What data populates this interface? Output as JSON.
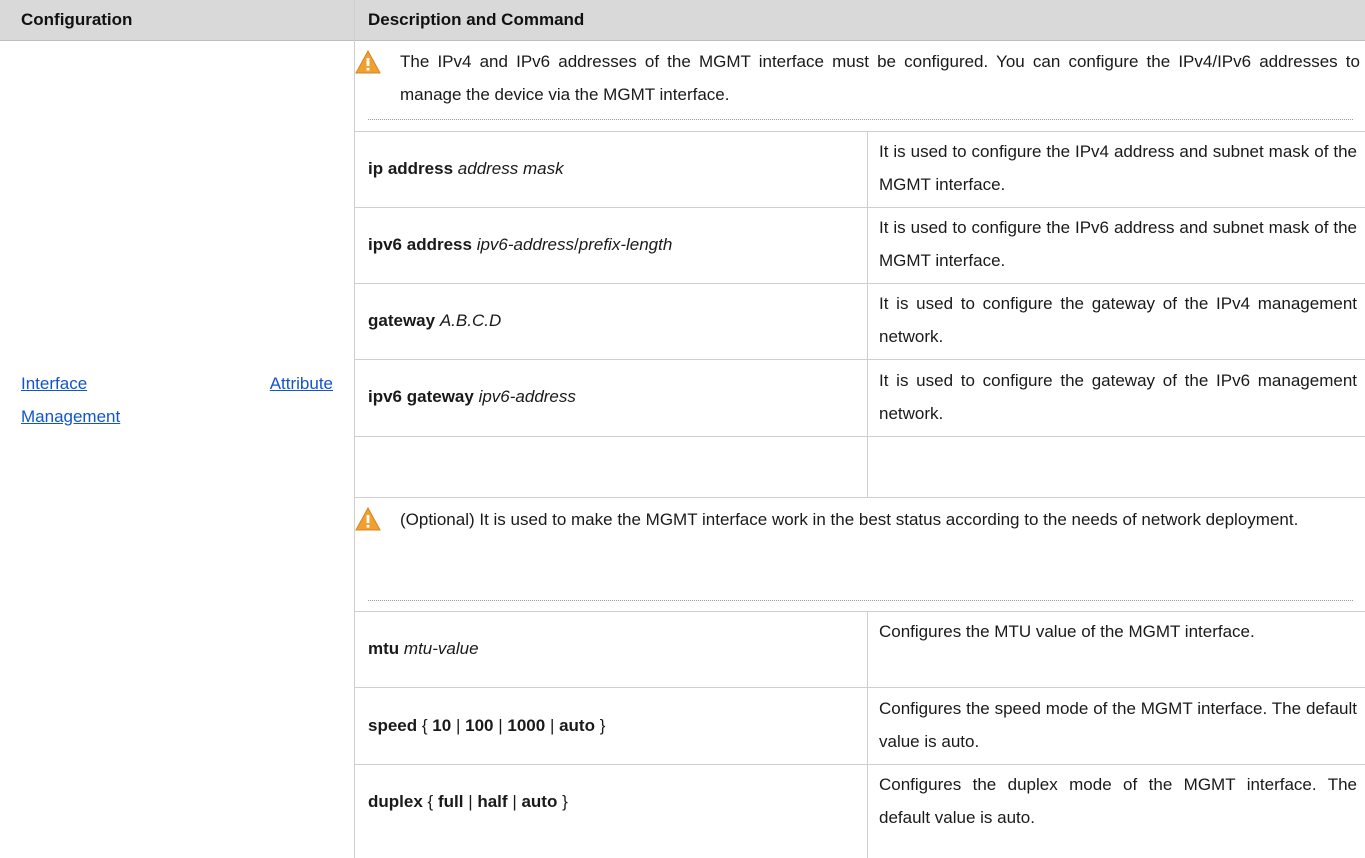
{
  "header": {
    "col_configuration": "Configuration",
    "col_description": "Description and Command"
  },
  "configuration_link": {
    "line1_word1": "Interface",
    "line1_word2": "Attribute",
    "line2": "Management"
  },
  "notes": [
    {
      "icon": "warning-icon",
      "text": "The IPv4 and IPv6 addresses of the MGMT interface must be configured. You can configure the IPv4/IPv6 addresses to manage the device via the MGMT interface."
    },
    {
      "icon": "warning-icon",
      "text": "(Optional) It is used to make the MGMT interface work in the best status according to the needs of network deployment."
    }
  ],
  "commands": [
    {
      "keyword": "ip address",
      "args": "address mask",
      "description": "It is used to configure the IPv4 address and subnet mask of the MGMT interface."
    },
    {
      "keyword": "ipv6 address",
      "arg1": "ipv6-address",
      "sep": "/",
      "arg2": "prefix-length",
      "description": "It is used to configure the IPv6 address and subnet mask of the MGMT interface."
    },
    {
      "keyword": "gateway",
      "args": "A.B.C.D",
      "description": "It is used to configure the gateway of the IPv4 management network."
    },
    {
      "keyword": "ipv6 gateway",
      "args": "ipv6-address",
      "description": "It is used to configure the gateway of the IPv6 management network."
    },
    {
      "keyword": "mtu",
      "args": "mtu-value",
      "description": "Configures the MTU value of the MGMT interface."
    },
    {
      "keyword": "speed",
      "open": "{",
      "opt1": "10",
      "bar": "|",
      "opt2": "100",
      "opt3": "1000",
      "opt4": "auto",
      "close": "}",
      "description": "Configures the speed mode of the MGMT interface. The default value is auto."
    },
    {
      "keyword": "duplex",
      "open": "{",
      "opt1": "full",
      "bar": "|",
      "opt2": "half",
      "opt3": "auto",
      "close": "}",
      "description": "Configures the duplex mode of the MGMT interface. The default value is auto."
    }
  ],
  "colors": {
    "header_bg": "#d9d9d9",
    "link": "#1155cc",
    "warning_fill": "#f0a030"
  }
}
